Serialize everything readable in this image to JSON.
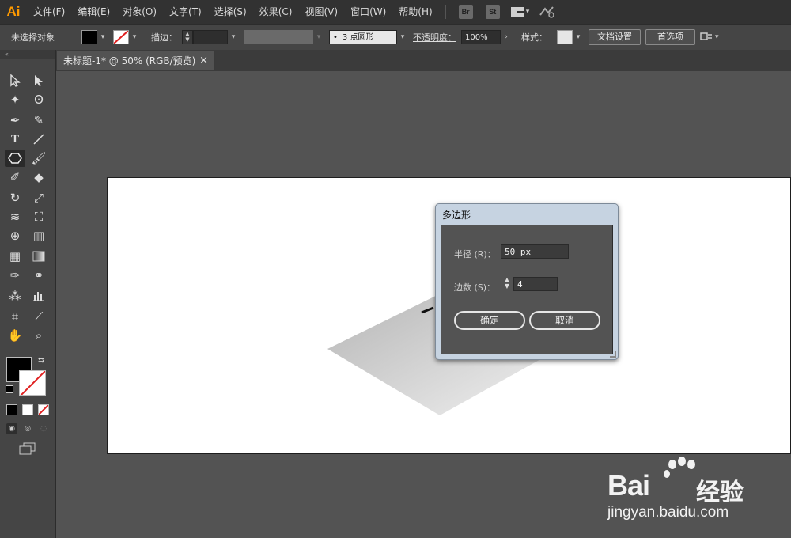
{
  "app": {
    "logo": "Ai"
  },
  "menubar": {
    "items": [
      "文件(F)",
      "编辑(E)",
      "对象(O)",
      "文字(T)",
      "选择(S)",
      "效果(C)",
      "视图(V)",
      "窗口(W)",
      "帮助(H)"
    ],
    "badges": [
      "Br",
      "St"
    ]
  },
  "controlbar": {
    "selection_status": "未选择对象",
    "stroke_label": "描边：",
    "brush_value": "3 点圆形",
    "opacity_label": "不透明度：",
    "opacity_value": "100%",
    "style_label": "样式：",
    "doc_setup_button": "文档设置",
    "preferences_button": "首选项"
  },
  "document": {
    "tab_title": "未标题-1* @ 50% (RGB/预览)",
    "close_glyph": "×"
  },
  "dialog": {
    "title": "多边形",
    "radius_label": "半径 (R)：",
    "radius_value": "50 px",
    "sides_label": "边数 (S)：",
    "sides_value": "4",
    "ok_button": "确定",
    "cancel_button": "取消"
  },
  "watermark": {
    "brand": "Bai",
    "brand_cn": "经验",
    "url": "jingyan.baidu.com"
  },
  "colors": {
    "logo": "#ff9a00",
    "fill": "#000000",
    "stroke_none_slash": "#e02020",
    "dialog_frame": "#c6d3e1"
  }
}
